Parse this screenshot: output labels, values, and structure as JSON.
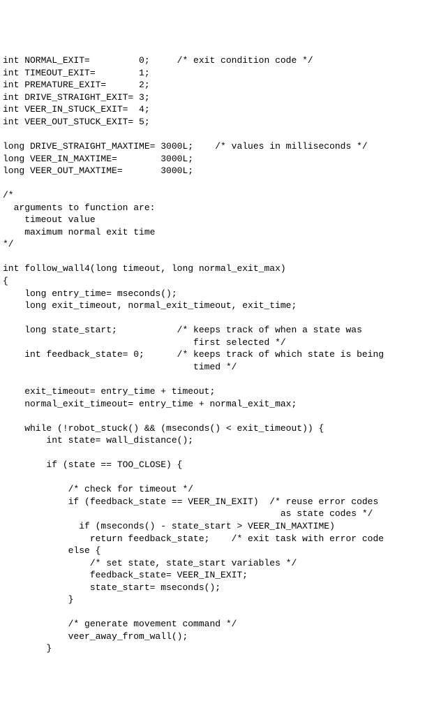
{
  "code": {
    "lines": [
      "int NORMAL_EXIT=         0;     /* exit condition code */",
      "int TIMEOUT_EXIT=        1;",
      "int PREMATURE_EXIT=      2;",
      "int DRIVE_STRAIGHT_EXIT= 3;",
      "int VEER_IN_STUCK_EXIT=  4;",
      "int VEER_OUT_STUCK_EXIT= 5;",
      "",
      "long DRIVE_STRAIGHT_MAXTIME= 3000L;    /* values in milliseconds */",
      "long VEER_IN_MAXTIME=        3000L;",
      "long VEER_OUT_MAXTIME=       3000L;",
      "",
      "/*",
      "  arguments to function are:",
      "    timeout value",
      "    maximum normal exit time",
      "*/",
      "",
      "int follow_wall4(long timeout, long normal_exit_max)",
      "{",
      "    long entry_time= mseconds();",
      "    long exit_timeout, normal_exit_timeout, exit_time;",
      "",
      "    long state_start;           /* keeps track of when a state was",
      "                                   first selected */",
      "    int feedback_state= 0;      /* keeps track of which state is being",
      "                                   timed */",
      "",
      "    exit_timeout= entry_time + timeout;",
      "    normal_exit_timeout= entry_time + normal_exit_max;",
      "",
      "    while (!robot_stuck() && (mseconds() < exit_timeout)) {",
      "        int state= wall_distance();",
      "",
      "        if (state == TOO_CLOSE) {",
      "",
      "            /* check for timeout */",
      "            if (feedback_state == VEER_IN_EXIT)  /* reuse error codes",
      "                                                   as state codes */",
      "              if (mseconds() - state_start > VEER_IN_MAXTIME)",
      "                return feedback_state;    /* exit task with error code",
      "            else {",
      "                /* set state, state_start variables */",
      "                feedback_state= VEER_IN_EXIT;",
      "                state_start= mseconds();",
      "            }",
      "",
      "            /* generate movement command */",
      "            veer_away_from_wall();",
      "        }"
    ]
  }
}
